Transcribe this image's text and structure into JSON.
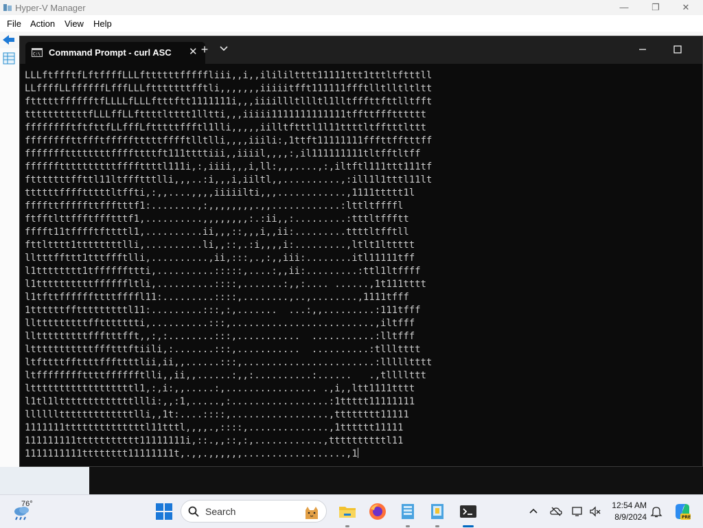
{
  "hyperv": {
    "title": "Hyper-V Manager",
    "minimize": "—",
    "maximize": "❐",
    "close": "✕",
    "menu": [
      "File",
      "Action",
      "View",
      "Help"
    ]
  },
  "terminal": {
    "tab_title": "Command Prompt - curl  ASC",
    "tab_close": "✕",
    "new_tab": "+",
    "lines": [
      "LLLftffftfLftffffLLLfttttttfffffliii,,i,,ilililtttt11111ttt1tttltftttll",
      "LLffffLLffffffLfffLLLftttttttfftli,,,,,,,iiiiitfft111111ffftlltlltltltt",
      "ftttttfffffftfLLLLfLLLftttftt1111111i,,,iiiillltllltl1lltfffttfttlltfft",
      "tttttttttttfLLLffLLfttttltttt1lltti,,,iiiii1111111111111tffttffftttttt",
      "fffffffftftfttfLLfffLftttttffftl1lli,,,,,iilltftttl1l11ttttltfftttlttt",
      "ffffffffttffftffffftttttfffftlltlli,,,,iiili:,1ttft11111111fffttfftttff",
      "fffffffttttttttffffttttft111ttttiii,,iiiil,,,,:,il111111111tltfftltff",
      "ffffffttttttttttffffttttl111i,:,iiii,,,i,ll:,,,....,:,iltftl111ttt111tf",
      "ftttttttffttl11ltffftttlli,,,..:i,,,i,iiltl,,..........,:ill1l1tttl11lt",
      "ttttttfffftttttltffti,:,,....,,,,iiiiilti,,,............,1111ttttt1l",
      "ffffttfffffttffftttf1:........,:,,,,,,,,.,,............:lttltffffl",
      "ftfftlttffftffftttf1,..........,,,,,,,,:.:ii,,:.........:tttltffftt",
      "fffft11tfffftfttttl1,..........ii,,,::,,,i,,ii:.........ttttltfftll",
      "fttltttt1ttttttttlli,..........li,,::,.:i,,,,i:.........,ltlt1lttttt",
      "lltttffttt1tttffftlli,..........,ii,:::,.,:,,iii:........itl11111tff",
      "l1tttttttt1tffffffttti,..........:::::,....:,,ii:.........:ttl1ltffff",
      "l1ttttttttttffffffltli,..........::::,.......:,,:.... ......,1t111tttt",
      "l1tfttffffffttttffffl11:.........::::,........,..,........,1111tfff",
      "1ttttttfftttttttttl11:.........:::,:,.......  ...:,,.........:111tfff",
      "lltttttttttffttttttti,..........:::,.........................,iltfff",
      "lltttttttttffftttfft,,:,:........:::,...........  ...........:lltfff",
      "ltttttttttttffftttftiili,:.......:::,...........  ..........:tllltttt",
      "ltfttttffttttfffttttlii,ii,,......:::,.......................:llllltttt",
      "ltffffffffttttfffffftlli,,ii,,......:,,:..........:......   .,tllllttt",
      "lttttttttttttttttttl1,:,i:,,.....:,................ .,i,,ltt1111tttt",
      "l1tl1ltttttttttttttllli:,,:1,.....,:.................:1ttttt11111111",
      "lllllltttttttttttttlli,,1t:....::::,.................,tttttttt11111",
      "1111111ttttttttttttttl11tttl,,,,.,::::,..............,1tttttt11111",
      "111111111ttttttttttt11111111i,::.,,::,:,............,ttttttttttl11",
      "1111111111tttttttt11111111t,.,,.,,,,,,..................,1"
    ]
  },
  "taskbar": {
    "weather_temp": "76°",
    "search_placeholder": "Search",
    "clock_time": "12:54 AM",
    "clock_date": "8/9/2024"
  }
}
